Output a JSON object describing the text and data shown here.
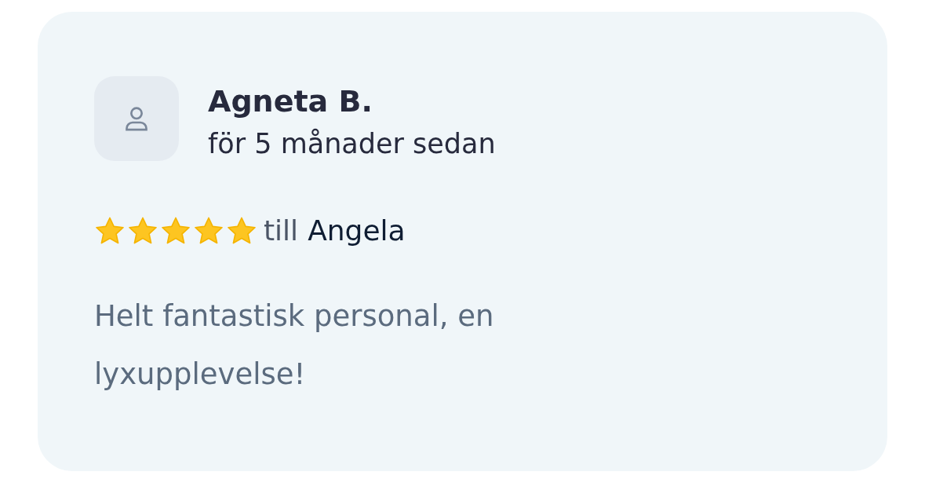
{
  "review": {
    "author": "Agneta B.",
    "time": "för 5 månader sedan",
    "stars": 5,
    "recipient_prefix": "till",
    "recipient": "Angela",
    "text": "Helt fantastisk personal, en lyxupplevelse!"
  }
}
